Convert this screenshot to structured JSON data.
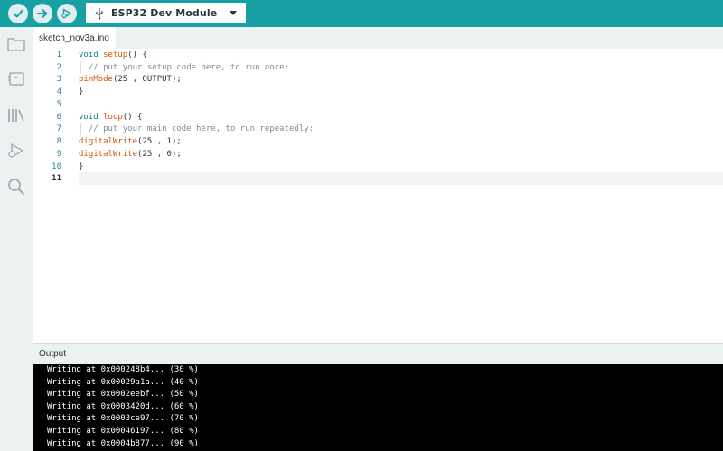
{
  "toolbar": {
    "verify_icon": "check-icon",
    "upload_icon": "arrow-right-icon",
    "debug_icon": "debug-icon",
    "board_name": "ESP32 Dev Module",
    "board_icon": "usb-icon"
  },
  "sidebar": {
    "items": [
      {
        "icon": "folder-icon",
        "name": "sketchbook"
      },
      {
        "icon": "board-icon",
        "name": "boards-manager"
      },
      {
        "icon": "library-icon",
        "name": "library-manager"
      },
      {
        "icon": "debug-icon",
        "name": "debug"
      },
      {
        "icon": "search-icon",
        "name": "search"
      }
    ]
  },
  "tab": {
    "filename": "sketch_nov3a.ino"
  },
  "editor": {
    "line_numbers": [
      "1",
      "2",
      "3",
      "4",
      "5",
      "6",
      "7",
      "8",
      "9",
      "10",
      "11"
    ],
    "active_line": "11",
    "lines": {
      "l1": {
        "kw": "void",
        "fn": "setup",
        "rest": "() {"
      },
      "l2": {
        "comment": "  // put your setup code here, to run once:"
      },
      "l3": {
        "fn": "pinMode",
        "rest": "(25 , OUTPUT);"
      },
      "l4": {
        "rest": "}"
      },
      "l6": {
        "kw": "void",
        "fn": "loop",
        "rest": "() {"
      },
      "l7": {
        "comment": "  // put your main code here, to run repeatedly:"
      },
      "l8": {
        "fn": "digitalWrite",
        "rest": "(25 , 1);"
      },
      "l9": {
        "fn": "digitalWrite",
        "rest": "(25 , 0);"
      },
      "l10": {
        "rest": "}"
      }
    }
  },
  "output": {
    "title": "Output",
    "lines": [
      "Writing at 0x000248b4... (30 %)",
      "Writing at 0x00029a1a... (40 %)",
      "Writing at 0x0002eebf... (50 %)",
      "Writing at 0x0003420d... (60 %)",
      "Writing at 0x0003ce97... (70 %)",
      "Writing at 0x00046197... (80 %)",
      "Writing at 0x0004b877... (90 %)"
    ]
  },
  "colors": {
    "toolbar": "#17a1a5",
    "sidebar": "#ecf1f1",
    "console_bg": "#000000",
    "keyword": "#0e7c86",
    "function": "#d35400",
    "comment": "#7f8c8d"
  }
}
